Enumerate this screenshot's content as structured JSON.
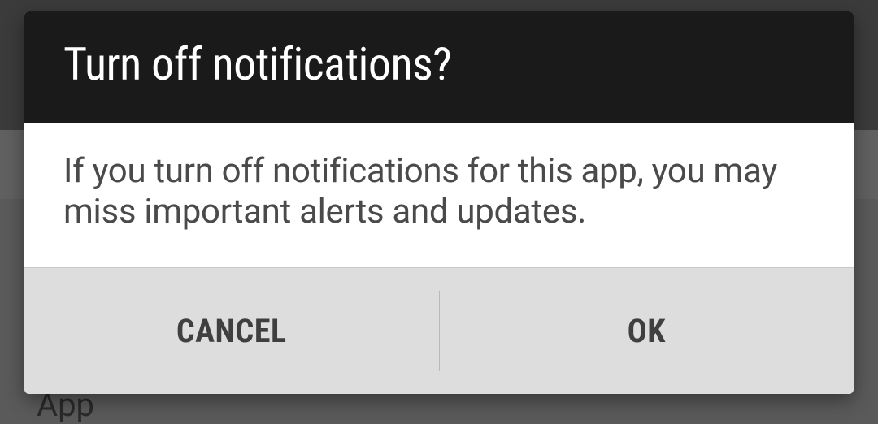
{
  "background": {
    "partial_text": "App"
  },
  "dialog": {
    "title": "Turn off notifications?",
    "message": "If you turn off notifications for this app, you may miss important alerts and updates.",
    "actions": {
      "cancel": "CANCEL",
      "ok": "OK"
    }
  }
}
